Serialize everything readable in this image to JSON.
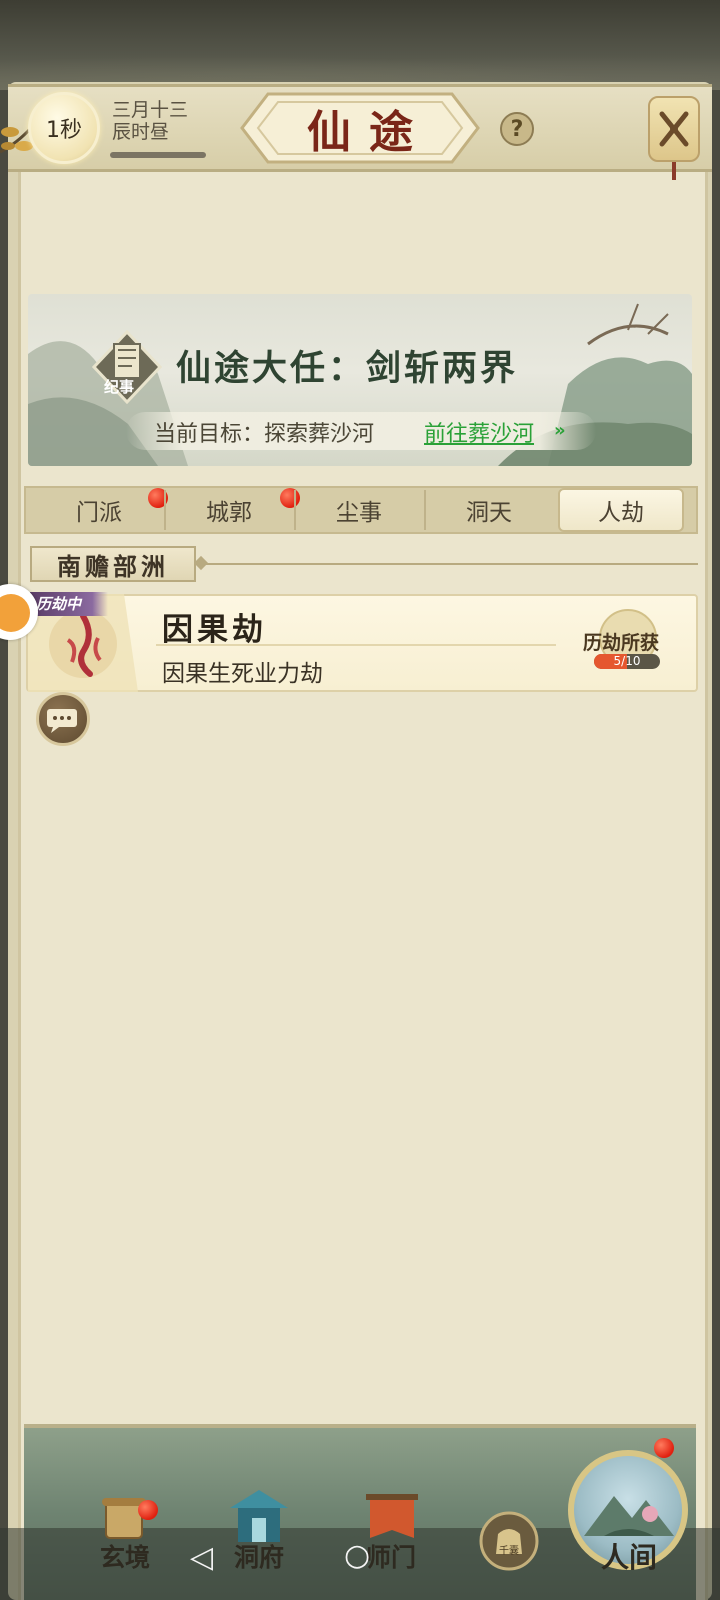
{
  "header": {
    "timer": "1秒",
    "date_line1": "三月十三",
    "date_line2": "辰时昼",
    "title": "仙途",
    "help_symbol": "?"
  },
  "banner": {
    "chronicle_label": "纪事",
    "quest_title": "仙途大任：剑斩两界",
    "goal_text": "当前目标：探索葬沙河",
    "goal_link": "前往葬沙河",
    "goal_arrow": "»"
  },
  "tabs": [
    {
      "label": "门派",
      "badge": true
    },
    {
      "label": "城郭",
      "badge": true
    },
    {
      "label": "尘事",
      "badge": false
    },
    {
      "label": "洞天",
      "badge": false
    },
    {
      "label": "人劫",
      "badge": false,
      "active": true
    }
  ],
  "region": {
    "name": "南赡部洲"
  },
  "tribulation": {
    "status": "历劫中",
    "title": "因果劫",
    "subtitle": "因果生死业力劫",
    "reward_label": "历劫所获",
    "reward_count": "5/10",
    "reward_progress": 0.5
  },
  "bottom_nav": [
    {
      "label": "玄境",
      "icon": "scroll-icon",
      "badge": true
    },
    {
      "label": "洞府",
      "icon": "pavilion-icon",
      "badge": false
    },
    {
      "label": "师门",
      "icon": "banner-icon",
      "badge": false
    },
    {
      "label": "千囊",
      "icon": "pouch-icon",
      "badge": false
    },
    {
      "label": "人间",
      "icon": "landscape-icon",
      "badge": true
    }
  ],
  "colors": {
    "title_red": "#7a2618",
    "link_green": "#2aa137",
    "badge_red": "#e0200f",
    "parchment": "#ebe5cd"
  }
}
